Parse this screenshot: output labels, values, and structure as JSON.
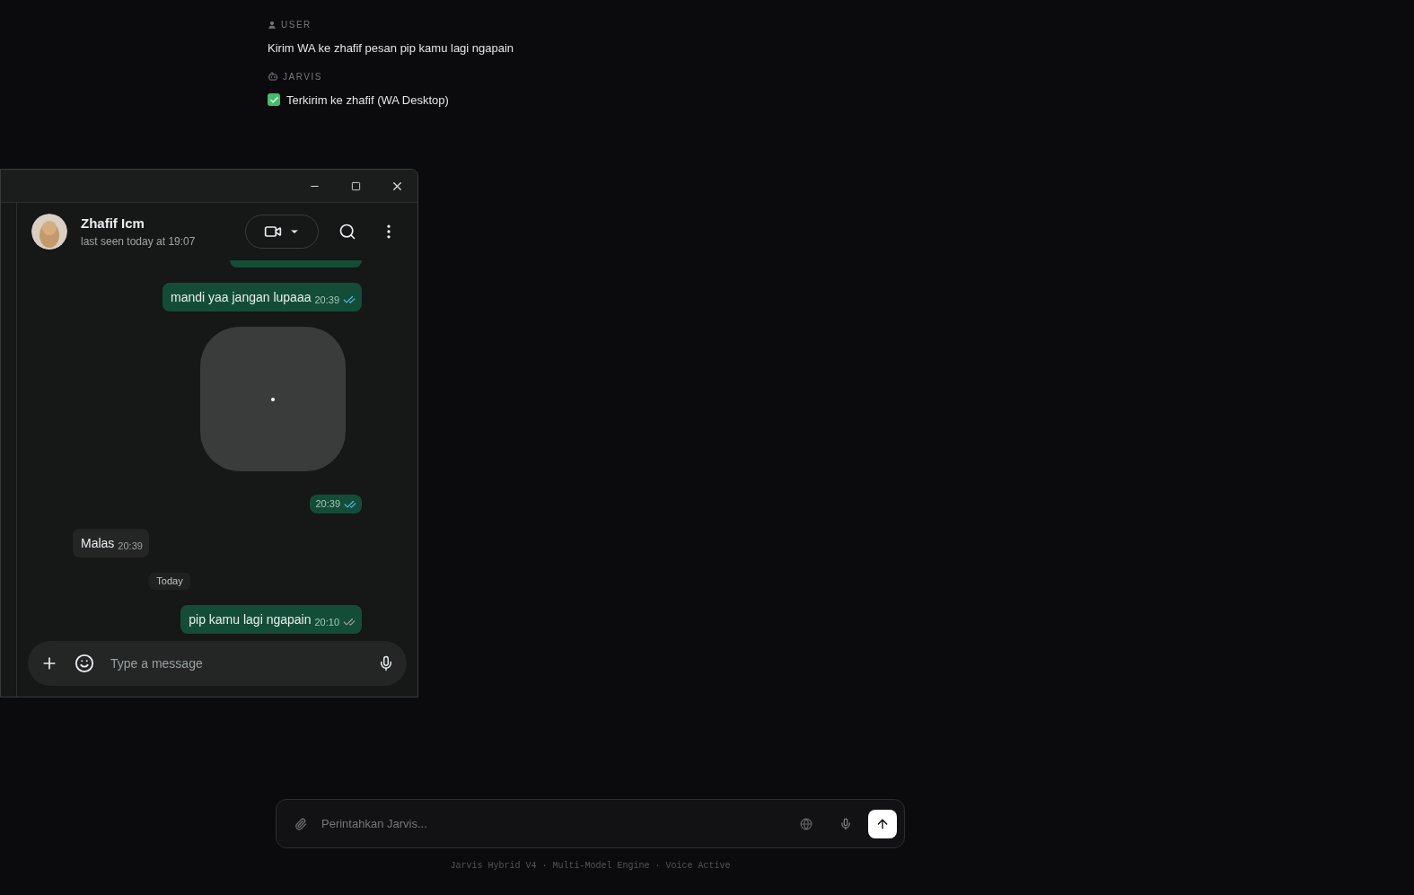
{
  "conversation": [
    {
      "role": "USER",
      "kind": "user",
      "text": "Kirim WA ke zhafif pesan pip kamu lagi ngapain"
    },
    {
      "role": "JARVIS",
      "kind": "assistant",
      "text": "Terkirim ke zhafif (WA Desktop)"
    }
  ],
  "whatsapp_window": {
    "contact": {
      "name": "Zhafif Icm",
      "status": "last seen today at 19:07"
    },
    "messages": [
      {
        "kind": "cut_off"
      },
      {
        "kind": "outgoing",
        "text": "mandi yaa jangan lupaaa",
        "time": "20:39",
        "read": true
      },
      {
        "kind": "image",
        "time": "20:39",
        "read": true
      },
      {
        "kind": "incoming",
        "text": "Malas",
        "time": "20:39"
      },
      {
        "kind": "date",
        "text": "Today"
      },
      {
        "kind": "outgoing",
        "text": "pip kamu lagi ngapain",
        "time": "20:10",
        "read": false
      }
    ],
    "composer": {
      "placeholder": "Type a message"
    }
  },
  "prompt_bar": {
    "placeholder": "Perintahkan Jarvis..."
  },
  "footer": "Jarvis Hybrid V4 · Multi-Model Engine · Voice Active"
}
